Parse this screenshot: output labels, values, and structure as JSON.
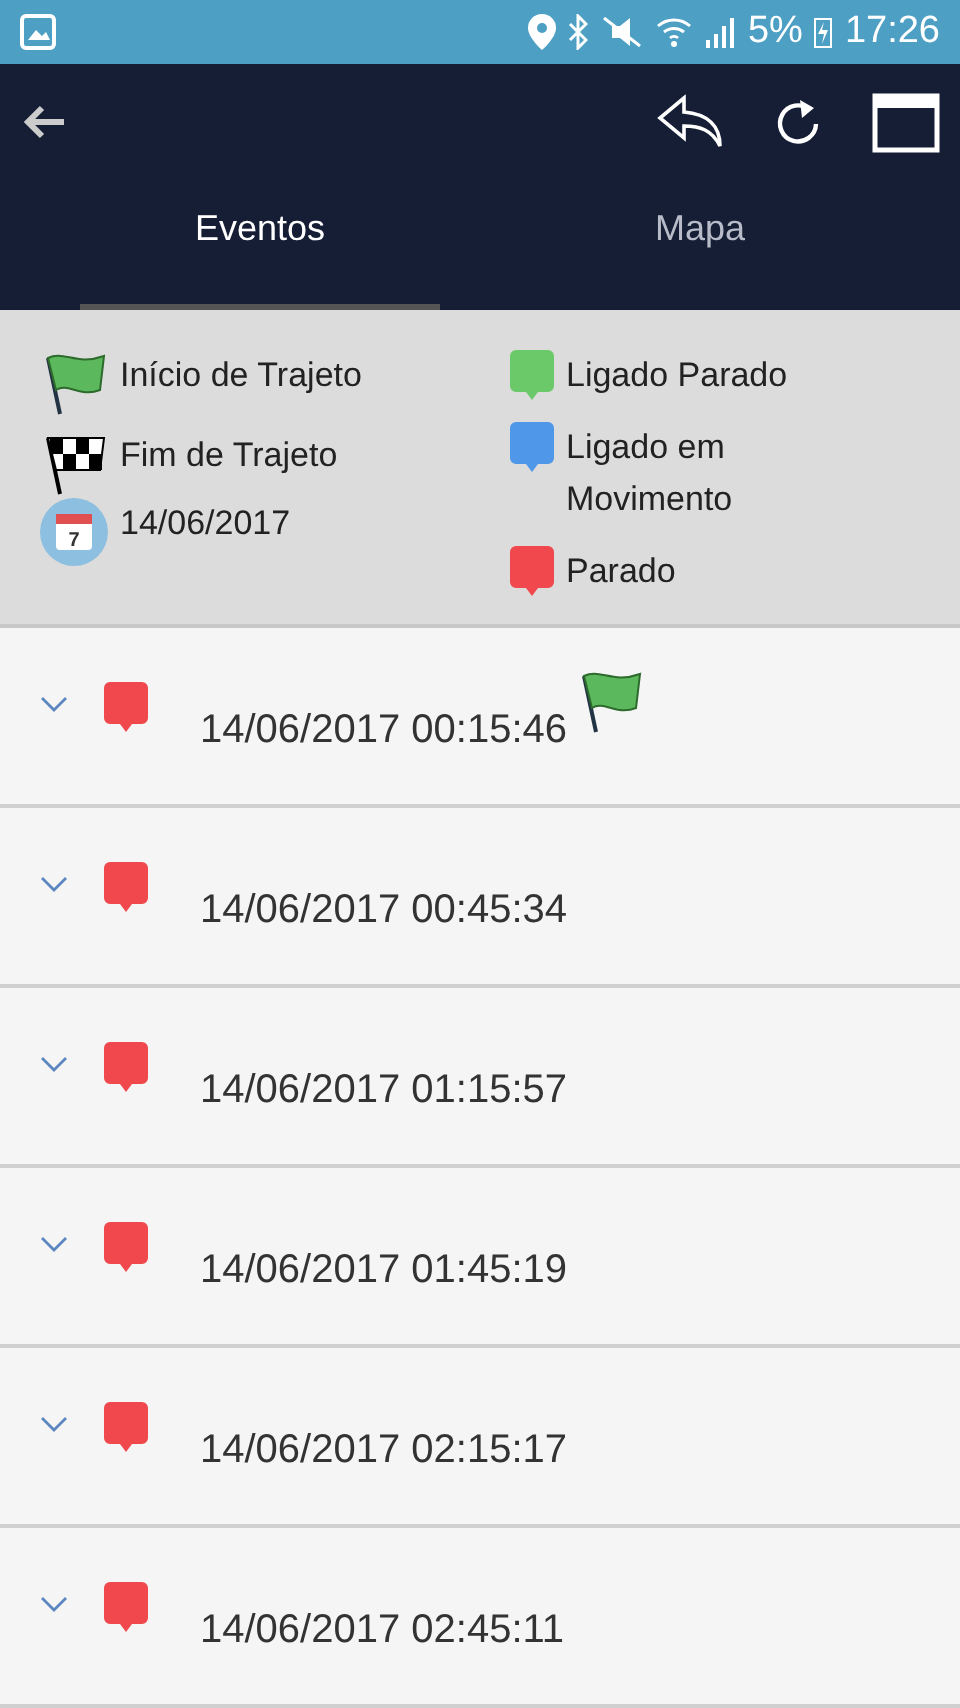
{
  "status_bar": {
    "battery": "5%",
    "time": "17:26"
  },
  "tabs": [
    {
      "label": "Eventos",
      "selected": true
    },
    {
      "label": "Mapa",
      "selected": false
    }
  ],
  "legend": {
    "left": [
      {
        "kind": "start-flag",
        "label": "Início de Trajeto"
      },
      {
        "kind": "finish-flag",
        "label": "Fim de Trajeto"
      },
      {
        "kind": "calendar",
        "label": "14/06/2017",
        "icon_text": "7"
      }
    ],
    "right": [
      {
        "label": "Ligado Parado",
        "color": "#6cc96a"
      },
      {
        "label": "Ligado em Movimento",
        "color": "#4f97e8"
      },
      {
        "label": "Parado",
        "color": "#f0484c"
      }
    ]
  },
  "events": [
    {
      "time": "14/06/2017 00:15:46",
      "color": "#f0484c",
      "start_flag": true,
      "expanded": false
    },
    {
      "time": "14/06/2017 00:45:34",
      "color": "#f0484c",
      "start_flag": false,
      "expanded": false
    },
    {
      "time": "14/06/2017 01:15:57",
      "color": "#f0484c",
      "start_flag": false,
      "expanded": false
    },
    {
      "time": "14/06/2017 01:45:19",
      "color": "#f0484c",
      "start_flag": false,
      "expanded": false
    },
    {
      "time": "14/06/2017 02:15:17",
      "color": "#f0484c",
      "start_flag": false,
      "expanded": false
    },
    {
      "time": "14/06/2017 02:45:11",
      "color": "#f0484c",
      "start_flag": false,
      "expanded": false
    }
  ]
}
